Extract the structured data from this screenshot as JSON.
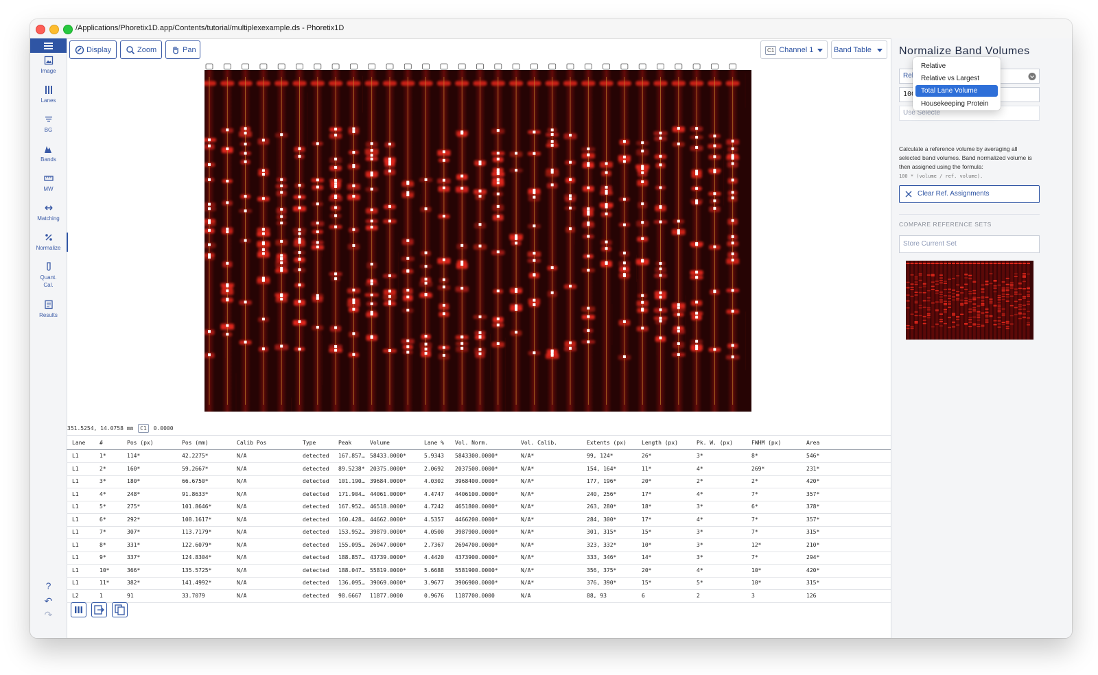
{
  "window": {
    "title": "/Applications/Phoretix1D.app/Contents/tutorial/multiplexexample.ds - Phoretix1D"
  },
  "sidebar": {
    "items": [
      {
        "label": "Image",
        "icon": "image-icon"
      },
      {
        "label": "Lanes",
        "icon": "lanes-icon"
      },
      {
        "label": "BG",
        "icon": "background-icon"
      },
      {
        "label": "Bands",
        "icon": "bands-icon"
      },
      {
        "label": "MW",
        "icon": "ruler-icon"
      },
      {
        "label": "Matching",
        "icon": "matching-icon"
      },
      {
        "label": "Normalize",
        "icon": "percent-icon"
      },
      {
        "label": "Quant.\nCal.",
        "icon": "tube-icon"
      },
      {
        "label": "Results",
        "icon": "results-icon"
      }
    ],
    "active": "Normalize",
    "help_glyph": "?",
    "undo_glyph": "↶",
    "redo_glyph": "↷"
  },
  "toolbar": {
    "display_label": "Display",
    "zoom_label": "Zoom",
    "pan_label": "Pan",
    "channel_tag": "C1",
    "channel_label": "Channel 1",
    "view_label": "Band Table"
  },
  "image": {
    "coords_text": "351.5254, 14.0758 mm",
    "channel_tag": "C1",
    "channel_value": "0.0000",
    "lane_count": 30,
    "colors": {
      "gel_bg": "#260404",
      "band": "#e0271b",
      "marker": "#ffffff",
      "lane_line": "#c8902c"
    }
  },
  "table": {
    "columns": [
      "Lane",
      "#",
      "Pos (px)",
      "Pos (mm)",
      "Calib Pos",
      "Type",
      "Peak",
      "Volume",
      "Lane %",
      "Vol. Norm.",
      "Vol. Calib.",
      "Extents (px)",
      "Length (px)",
      "Pk. W. (px)",
      "FWHM (px)",
      "Area"
    ],
    "rows": [
      [
        "L1",
        "1*",
        "114*",
        "42.2275*",
        "N/A",
        "detected",
        "167.857…",
        "58433.0000*",
        "5.9343",
        "5843300.0000*",
        "N/A*",
        "99, 124*",
        "26*",
        "3*",
        "8*",
        "546*"
      ],
      [
        "L1",
        "2*",
        "160*",
        "59.2667*",
        "N/A",
        "detected",
        "89.5238*",
        "20375.0000*",
        "2.0692",
        "2037500.0000*",
        "N/A*",
        "154, 164*",
        "11*",
        "4*",
        "269*",
        "231*"
      ],
      [
        "L1",
        "3*",
        "180*",
        "66.6750*",
        "N/A",
        "detected",
        "101.190…",
        "39684.0000*",
        "4.0302",
        "3968400.0000*",
        "N/A*",
        "177, 196*",
        "20*",
        "2*",
        "2*",
        "420*"
      ],
      [
        "L1",
        "4*",
        "248*",
        "91.8633*",
        "N/A",
        "detected",
        "171.904…",
        "44061.0000*",
        "4.4747",
        "4406100.0000*",
        "N/A*",
        "240, 256*",
        "17*",
        "4*",
        "7*",
        "357*"
      ],
      [
        "L1",
        "5*",
        "275*",
        "101.8646*",
        "N/A",
        "detected",
        "167.952…",
        "46518.0000*",
        "4.7242",
        "4651800.0000*",
        "N/A*",
        "263, 280*",
        "18*",
        "3*",
        "6*",
        "378*"
      ],
      [
        "L1",
        "6*",
        "292*",
        "108.1617*",
        "N/A",
        "detected",
        "160.428…",
        "44662.0000*",
        "4.5357",
        "4466200.0000*",
        "N/A*",
        "284, 300*",
        "17*",
        "4*",
        "7*",
        "357*"
      ],
      [
        "L1",
        "7*",
        "307*",
        "113.7179*",
        "N/A",
        "detected",
        "153.952…",
        "39879.0000*",
        "4.0500",
        "3987900.0000*",
        "N/A*",
        "301, 315*",
        "15*",
        "3*",
        "7*",
        "315*"
      ],
      [
        "L1",
        "8*",
        "331*",
        "122.6079*",
        "N/A",
        "detected",
        "155.095…",
        "26947.0000*",
        "2.7367",
        "2694700.0000*",
        "N/A*",
        "323, 332*",
        "10*",
        "3*",
        "12*",
        "210*"
      ],
      [
        "L1",
        "9*",
        "337*",
        "124.8304*",
        "N/A",
        "detected",
        "188.857…",
        "43739.0000*",
        "4.4420",
        "4373900.0000*",
        "N/A*",
        "333, 346*",
        "14*",
        "3*",
        "7*",
        "294*"
      ],
      [
        "L1",
        "10*",
        "366*",
        "135.5725*",
        "N/A",
        "detected",
        "188.047…",
        "55819.0000*",
        "5.6688",
        "5581900.0000*",
        "N/A*",
        "356, 375*",
        "20*",
        "4*",
        "10*",
        "420*"
      ],
      [
        "L1",
        "11*",
        "382*",
        "141.4992*",
        "N/A",
        "detected",
        "136.095…",
        "39069.0000*",
        "3.9677",
        "3906900.0000*",
        "N/A*",
        "376, 390*",
        "15*",
        "5*",
        "10*",
        "315*"
      ],
      [
        "L2",
        "1",
        "91",
        "33.7079",
        "N/A",
        "detected",
        "98.6667",
        "11877.0000",
        "0.9676",
        "1187700.0000",
        "N/A",
        "88, 93",
        "6",
        "2",
        "3",
        "126"
      ]
    ]
  },
  "bottom_toolbar": {
    "buttons": [
      {
        "icon": "columns-icon"
      },
      {
        "icon": "export-icon"
      },
      {
        "icon": "copy-icon"
      }
    ]
  },
  "panel": {
    "title": "Normalize Band Volumes",
    "method_value": "Relative",
    "amount_value": "100",
    "use_selected_label": "Use Selecte",
    "description": "Calculate a reference volume by averaging all selected band volumes. Band normalized volume is then assigned using the formula:",
    "formula": "100 * (volume / ref. volume).",
    "clear_label": "Clear Ref. Assignments",
    "compare_heading": "COMPARE REFERENCE SETS",
    "store_label": "Store Current Set"
  },
  "dropdown": {
    "options": [
      "Relative",
      "Relative vs Largest",
      "Total Lane Volume",
      "Housekeeping Protein"
    ],
    "selected": "Total Lane Volume"
  }
}
